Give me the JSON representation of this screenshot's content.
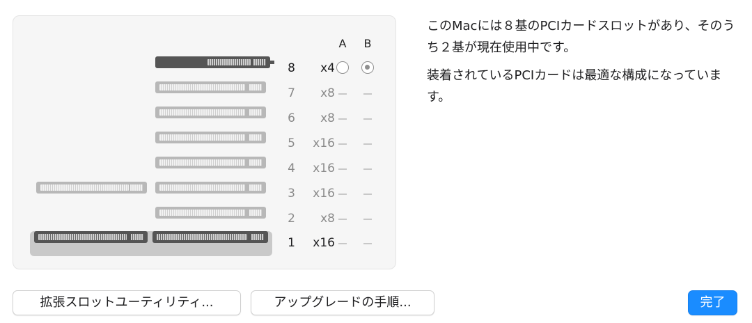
{
  "columns": {
    "a": "A",
    "b": "B"
  },
  "slots": [
    {
      "number": "8",
      "width": "x4",
      "installed": true,
      "selected": "B"
    },
    {
      "number": "7",
      "width": "x8",
      "installed": false,
      "a": "—",
      "b": "—"
    },
    {
      "number": "6",
      "width": "x8",
      "installed": false,
      "a": "—",
      "b": "—"
    },
    {
      "number": "5",
      "width": "x16",
      "installed": false,
      "a": "—",
      "b": "—"
    },
    {
      "number": "4",
      "width": "x16",
      "installed": false,
      "a": "—",
      "b": "—"
    },
    {
      "number": "3",
      "width": "x16",
      "installed": false,
      "a": "—",
      "b": "—"
    },
    {
      "number": "2",
      "width": "x8",
      "installed": false,
      "a": "—",
      "b": "—"
    },
    {
      "number": "1",
      "width": "x16",
      "installed": true,
      "a": "—",
      "b": "—"
    }
  ],
  "description": {
    "line1": "このMacには８基のPCIカードスロットがあり、そのうち２基が現在使用中です。",
    "line2": "装着されているPCIカードは最適な構成になっています。"
  },
  "buttons": {
    "expansion_utility": "拡張スロットユーティリティ...",
    "upgrade_steps": "アップグレードの手順...",
    "done": "完了"
  },
  "colors": {
    "accent": "#1a8cff",
    "installed_card": "#555555",
    "empty_card": "#b8b8b8"
  }
}
